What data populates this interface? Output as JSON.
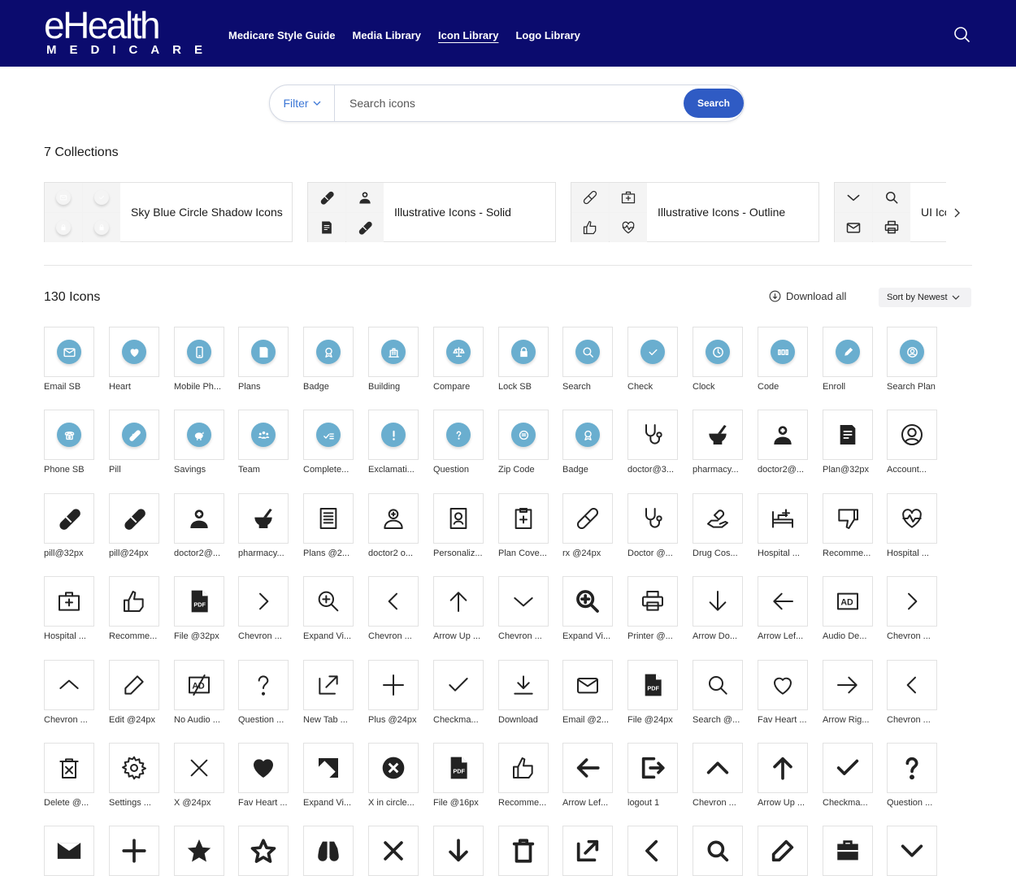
{
  "brand": {
    "line1": "eHealth",
    "line2": "MEDICARE"
  },
  "nav": [
    {
      "label": "Medicare Style Guide",
      "active": false
    },
    {
      "label": "Media Library",
      "active": false
    },
    {
      "label": "Icon Library",
      "active": true
    },
    {
      "label": "Logo Library",
      "active": false
    }
  ],
  "search": {
    "filter_label": "Filter",
    "placeholder": "Search icons",
    "button_label": "Search"
  },
  "collections_title": "7 Collections",
  "collections": [
    {
      "name": "Sky Blue Circle Shadow Icons",
      "thumbs": [
        "email-icon",
        "check-icon",
        "lock-icon",
        "lock-icon"
      ],
      "style": "circle"
    },
    {
      "name": "Illustrative Icons - Solid",
      "thumbs": [
        "pill-icon",
        "doctor-icon",
        "plans-icon",
        "pill-icon"
      ],
      "style": "solid"
    },
    {
      "name": "Illustrative Icons - Outline",
      "thumbs": [
        "rx-icon",
        "first-aid-kit-icon",
        "thumbs-up-icon",
        "heart-pulse-icon"
      ],
      "style": "outline"
    },
    {
      "name": "UI Ico",
      "thumbs": [
        "chevron-down-icon",
        "search-icon",
        "email-icon",
        "printer-icon"
      ],
      "style": "ui"
    }
  ],
  "icons_title": "130 Icons",
  "download_all": "Download all",
  "sort_label": "Sort by Newest",
  "colors": {
    "nav_bg": "#0b0b6e",
    "accent": "#2f5bc4",
    "sky_blue": "#6aaecf"
  },
  "icons": [
    {
      "label": "Email SB",
      "icon": "email-icon",
      "style": "circle"
    },
    {
      "label": "Heart",
      "icon": "heart-icon",
      "style": "circle"
    },
    {
      "label": "Mobile Ph...",
      "icon": "mobile-phone-icon",
      "style": "circle"
    },
    {
      "label": "Plans",
      "icon": "plans-icon",
      "style": "circle"
    },
    {
      "label": "Badge",
      "icon": "badge-icon",
      "style": "circle"
    },
    {
      "label": "Building",
      "icon": "building-icon",
      "style": "circle"
    },
    {
      "label": "Compare",
      "icon": "compare-icon",
      "style": "circle"
    },
    {
      "label": "Lock SB",
      "icon": "lock-icon",
      "style": "circle"
    },
    {
      "label": "Search",
      "icon": "search-icon",
      "style": "circle"
    },
    {
      "label": "Check",
      "icon": "check-icon",
      "style": "circle"
    },
    {
      "label": "Clock",
      "icon": "clock-icon",
      "style": "circle"
    },
    {
      "label": "Code",
      "icon": "code-icon",
      "style": "circle"
    },
    {
      "label": "Enroll",
      "icon": "enroll-icon",
      "style": "circle"
    },
    {
      "label": "Search Plan",
      "icon": "search-plan-icon",
      "style": "circle"
    },
    {
      "label": "Phone SB",
      "icon": "phone-icon",
      "style": "circle"
    },
    {
      "label": "Pill",
      "icon": "pill-icon",
      "style": "circle"
    },
    {
      "label": "Savings",
      "icon": "savings-icon",
      "style": "circle"
    },
    {
      "label": "Team",
      "icon": "team-icon",
      "style": "circle"
    },
    {
      "label": "Complete...",
      "icon": "complete-icon",
      "style": "circle"
    },
    {
      "label": "Exclamati...",
      "icon": "exclamation-icon",
      "style": "circle"
    },
    {
      "label": "Question",
      "icon": "question-icon",
      "style": "circle"
    },
    {
      "label": "Zip Code",
      "icon": "zip-code-icon",
      "style": "circle"
    },
    {
      "label": "Badge",
      "icon": "badge-icon",
      "style": "circle"
    },
    {
      "label": "doctor@3...",
      "icon": "stethoscope-icon",
      "style": "line"
    },
    {
      "label": "pharmacy...",
      "icon": "pharmacy-icon",
      "style": "solid"
    },
    {
      "label": "doctor2@...",
      "icon": "doctor-icon",
      "style": "solid"
    },
    {
      "label": "Plan@32px",
      "icon": "plans-icon",
      "style": "solid"
    },
    {
      "label": "Account...",
      "icon": "account-icon",
      "style": "line"
    },
    {
      "label": "pill@32px",
      "icon": "pill-icon",
      "style": "solid"
    },
    {
      "label": "pill@24px",
      "icon": "pill-icon",
      "style": "solid"
    },
    {
      "label": "doctor2@...",
      "icon": "doctor-icon",
      "style": "solid"
    },
    {
      "label": "pharmacy...",
      "icon": "pharmacy-icon",
      "style": "solid"
    },
    {
      "label": "Plans @2...",
      "icon": "plans-outline-icon",
      "style": "line"
    },
    {
      "label": "doctor2 o...",
      "icon": "doctor-outline-icon",
      "style": "line"
    },
    {
      "label": "Personaliz...",
      "icon": "personalize-icon",
      "style": "line"
    },
    {
      "label": "Plan Cove...",
      "icon": "plan-coverage-icon",
      "style": "line"
    },
    {
      "label": "rx @24px",
      "icon": "rx-icon",
      "style": "line"
    },
    {
      "label": "Doctor @...",
      "icon": "stethoscope-icon",
      "style": "line"
    },
    {
      "label": "Drug Cos...",
      "icon": "drug-cost-icon",
      "style": "line"
    },
    {
      "label": "Hospital ...",
      "icon": "hospital-bed-icon",
      "style": "line"
    },
    {
      "label": "Recomme...",
      "icon": "thumbs-down-icon",
      "style": "line"
    },
    {
      "label": "Hospital ...",
      "icon": "heart-pulse-icon",
      "style": "line"
    },
    {
      "label": "Hospital ...",
      "icon": "first-aid-kit-icon",
      "style": "line"
    },
    {
      "label": "Recomme...",
      "icon": "thumbs-up-icon",
      "style": "line"
    },
    {
      "label": "File @32px",
      "icon": "pdf-file-icon",
      "style": "solid"
    },
    {
      "label": "Chevron ...",
      "icon": "chevron-right-icon",
      "style": "line"
    },
    {
      "label": "Expand Vi...",
      "icon": "zoom-in-icon",
      "style": "line"
    },
    {
      "label": "Chevron ...",
      "icon": "chevron-left-icon",
      "style": "line"
    },
    {
      "label": "Arrow Up ...",
      "icon": "arrow-up-icon",
      "style": "line"
    },
    {
      "label": "Chevron ...",
      "icon": "chevron-down-icon",
      "style": "line"
    },
    {
      "label": "Expand Vi...",
      "icon": "zoom-in-bold-icon",
      "style": "bold"
    },
    {
      "label": "Printer @...",
      "icon": "printer-icon",
      "style": "line"
    },
    {
      "label": "Arrow Do...",
      "icon": "arrow-down-icon",
      "style": "line"
    },
    {
      "label": "Arrow Lef...",
      "icon": "arrow-left-icon",
      "style": "line"
    },
    {
      "label": "Audio De...",
      "icon": "audio-description-icon",
      "style": "line"
    },
    {
      "label": "Chevron ...",
      "icon": "chevron-right-icon",
      "style": "line"
    },
    {
      "label": "Chevron ...",
      "icon": "chevron-up-icon",
      "style": "line"
    },
    {
      "label": "Edit @24px",
      "icon": "edit-icon",
      "style": "line"
    },
    {
      "label": "No Audio ...",
      "icon": "no-audio-description-icon",
      "style": "line"
    },
    {
      "label": "Question ...",
      "icon": "question-mark-icon",
      "style": "line"
    },
    {
      "label": "New Tab ...",
      "icon": "new-tab-icon",
      "style": "line"
    },
    {
      "label": "Plus @24px",
      "icon": "plus-icon",
      "style": "line"
    },
    {
      "label": "Checkma...",
      "icon": "checkmark-icon",
      "style": "line"
    },
    {
      "label": "Download",
      "icon": "download-icon",
      "style": "line"
    },
    {
      "label": "Email @2...",
      "icon": "email-outline-icon",
      "style": "line"
    },
    {
      "label": "File @24px",
      "icon": "pdf-file-icon",
      "style": "solid"
    },
    {
      "label": "Search @...",
      "icon": "search-icon",
      "style": "line"
    },
    {
      "label": "Fav Heart ...",
      "icon": "heart-outline-icon",
      "style": "line"
    },
    {
      "label": "Arrow Rig...",
      "icon": "arrow-right-icon",
      "style": "line"
    },
    {
      "label": "Chevron ...",
      "icon": "chevron-left-icon",
      "style": "line"
    },
    {
      "label": "Delete @...",
      "icon": "delete-icon",
      "style": "line"
    },
    {
      "label": "Settings ...",
      "icon": "gear-icon",
      "style": "line"
    },
    {
      "label": "X @24px",
      "icon": "close-icon",
      "style": "line"
    },
    {
      "label": "Fav Heart ...",
      "icon": "heart-solid-icon",
      "style": "solid"
    },
    {
      "label": "Expand Vi...",
      "icon": "expand-icon",
      "style": "solid"
    },
    {
      "label": "X in circle...",
      "icon": "x-circle-icon",
      "style": "solid"
    },
    {
      "label": "File @16px",
      "icon": "pdf-file-icon",
      "style": "solid"
    },
    {
      "label": "Recomme...",
      "icon": "thumbs-up-icon",
      "style": "line"
    },
    {
      "label": "Arrow Lef...",
      "icon": "arrow-left-bold-icon",
      "style": "bold"
    },
    {
      "label": "logout 1",
      "icon": "logout-icon",
      "style": "bold"
    },
    {
      "label": "Chevron ...",
      "icon": "chevron-up-bold-icon",
      "style": "bold"
    },
    {
      "label": "Arrow Up ...",
      "icon": "arrow-up-bold-icon",
      "style": "bold"
    },
    {
      "label": "Checkma...",
      "icon": "checkmark-bold-icon",
      "style": "bold"
    },
    {
      "label": "Question ...",
      "icon": "question-mark-bold-icon",
      "style": "bold"
    },
    {
      "label": "",
      "icon": "email-solid-icon",
      "style": "bold"
    },
    {
      "label": "",
      "icon": "plus-bold-icon",
      "style": "bold"
    },
    {
      "label": "",
      "icon": "star-solid-icon",
      "style": "bold"
    },
    {
      "label": "",
      "icon": "star-outline-icon",
      "style": "bold"
    },
    {
      "label": "",
      "icon": "binoculars-icon",
      "style": "bold"
    },
    {
      "label": "",
      "icon": "close-bold-icon",
      "style": "bold"
    },
    {
      "label": "",
      "icon": "arrow-down-bold-icon",
      "style": "bold"
    },
    {
      "label": "",
      "icon": "trash-bold-icon",
      "style": "bold"
    },
    {
      "label": "",
      "icon": "new-tab-bold-icon",
      "style": "bold"
    },
    {
      "label": "",
      "icon": "chevron-left-bold-icon",
      "style": "bold"
    },
    {
      "label": "",
      "icon": "search-bold-icon",
      "style": "bold"
    },
    {
      "label": "",
      "icon": "edit-bold-icon",
      "style": "bold"
    },
    {
      "label": "",
      "icon": "briefcase-icon",
      "style": "bold"
    },
    {
      "label": "",
      "icon": "chevron-down-bold-icon",
      "style": "bold"
    }
  ]
}
